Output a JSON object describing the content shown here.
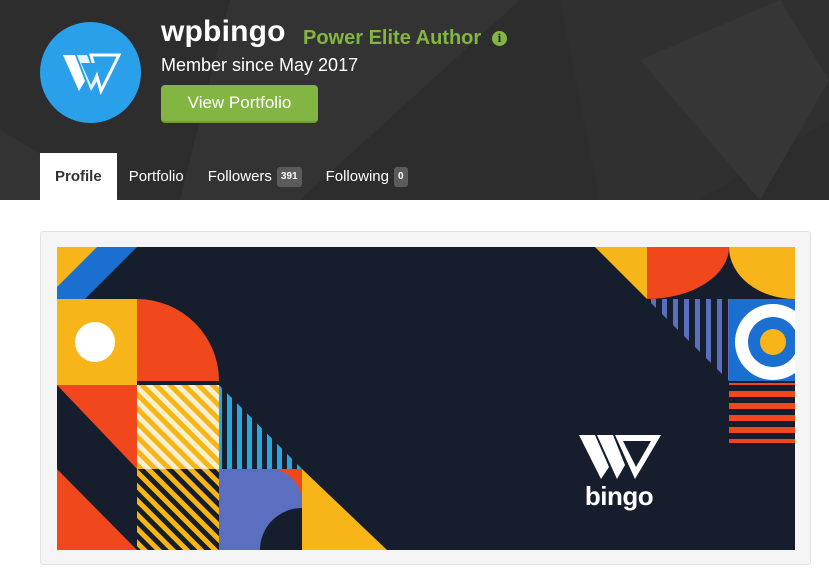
{
  "profile": {
    "username": "wpbingo",
    "author_level": "Power Elite Author",
    "info_icon": "info-icon",
    "member_since": "Member since May 2017",
    "view_portfolio_label": "View Portfolio"
  },
  "tabs": [
    {
      "label": "Profile",
      "active": true
    },
    {
      "label": "Portfolio",
      "active": false
    },
    {
      "label": "Followers",
      "count": "391",
      "active": false
    },
    {
      "label": "Following",
      "count": "0",
      "active": false
    }
  ],
  "banner": {
    "logo_text": "bingo"
  },
  "colors": {
    "header_bg": "#2d2d2d",
    "accent_green": "#82b541",
    "avatar_blue": "#2aa0ea",
    "banner_bg": "#161e2d"
  }
}
